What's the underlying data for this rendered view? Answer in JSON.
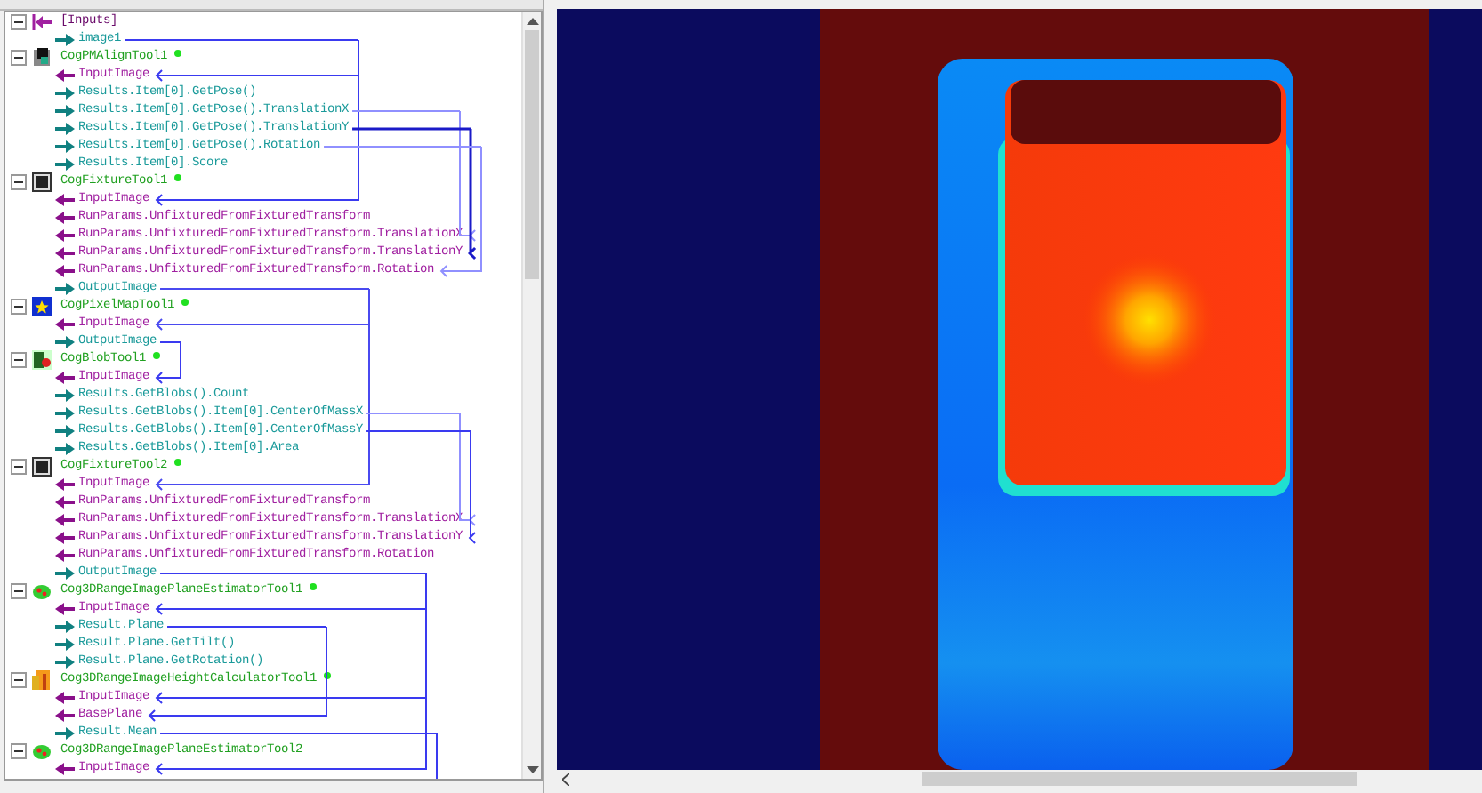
{
  "tree": [
    {
      "kind": "inputs",
      "label": "[Inputs]",
      "expanded": true,
      "children": [
        {
          "label": "image1",
          "kind": "output"
        }
      ]
    },
    {
      "kind": "pmalign",
      "label": "CogPMAlignTool1",
      "ran": true,
      "expanded": true,
      "children": [
        {
          "label": "InputImage",
          "kind": "input"
        },
        {
          "label": "Results.Item[0].GetPose()",
          "kind": "output"
        },
        {
          "label": "Results.Item[0].GetPose().TranslationX",
          "kind": "output"
        },
        {
          "label": "Results.Item[0].GetPose().TranslationY",
          "kind": "output"
        },
        {
          "label": "Results.Item[0].GetPose().Rotation",
          "kind": "output"
        },
        {
          "label": "Results.Item[0].Score",
          "kind": "output"
        }
      ]
    },
    {
      "kind": "fixture",
      "label": "CogFixtureTool1",
      "ran": true,
      "expanded": true,
      "children": [
        {
          "label": "InputImage",
          "kind": "input"
        },
        {
          "label": "RunParams.UnfixturedFromFixturedTransform",
          "kind": "input"
        },
        {
          "label": "RunParams.UnfixturedFromFixturedTransform.TranslationX",
          "kind": "input"
        },
        {
          "label": "RunParams.UnfixturedFromFixturedTransform.TranslationY",
          "kind": "input"
        },
        {
          "label": "RunParams.UnfixturedFromFixturedTransform.Rotation",
          "kind": "input"
        },
        {
          "label": "OutputImage",
          "kind": "output"
        }
      ]
    },
    {
      "kind": "pixelmap",
      "label": "CogPixelMapTool1",
      "ran": true,
      "expanded": true,
      "children": [
        {
          "label": "InputImage",
          "kind": "input"
        },
        {
          "label": "OutputImage",
          "kind": "output"
        }
      ]
    },
    {
      "kind": "blob",
      "label": "CogBlobTool1",
      "ran": true,
      "expanded": true,
      "children": [
        {
          "label": "InputImage",
          "kind": "input"
        },
        {
          "label": "Results.GetBlobs().Count",
          "kind": "output"
        },
        {
          "label": "Results.GetBlobs().Item[0].CenterOfMassX",
          "kind": "output"
        },
        {
          "label": "Results.GetBlobs().Item[0].CenterOfMassY",
          "kind": "output"
        },
        {
          "label": "Results.GetBlobs().Item[0].Area",
          "kind": "output"
        }
      ]
    },
    {
      "kind": "fixture",
      "label": "CogFixtureTool2",
      "ran": true,
      "expanded": true,
      "children": [
        {
          "label": "InputImage",
          "kind": "input"
        },
        {
          "label": "RunParams.UnfixturedFromFixturedTransform",
          "kind": "input"
        },
        {
          "label": "RunParams.UnfixturedFromFixturedTransform.TranslationX",
          "kind": "input"
        },
        {
          "label": "RunParams.UnfixturedFromFixturedTransform.TranslationY",
          "kind": "input"
        },
        {
          "label": "RunParams.UnfixturedFromFixturedTransform.Rotation",
          "kind": "input"
        },
        {
          "label": "OutputImage",
          "kind": "output"
        }
      ]
    },
    {
      "kind": "planeestimator",
      "label": "Cog3DRangeImagePlaneEstimatorTool1",
      "ran": true,
      "expanded": true,
      "children": [
        {
          "label": "InputImage",
          "kind": "input"
        },
        {
          "label": "Result.Plane",
          "kind": "output"
        },
        {
          "label": "Result.Plane.GetTilt()",
          "kind": "output"
        },
        {
          "label": "Result.Plane.GetRotation()",
          "kind": "output"
        }
      ]
    },
    {
      "kind": "heightcalculator",
      "label": "Cog3DRangeImageHeightCalculatorTool1",
      "ran": true,
      "expanded": true,
      "children": [
        {
          "label": "InputImage",
          "kind": "input"
        },
        {
          "label": "BasePlane",
          "kind": "input"
        },
        {
          "label": "Result.Mean",
          "kind": "output"
        }
      ]
    },
    {
      "kind": "planeestimator",
      "label": "Cog3DRangeImagePlaneEstimatorTool2",
      "ran": false,
      "expanded": true,
      "children": [
        {
          "label": "InputImage",
          "kind": "input"
        }
      ]
    }
  ]
}
